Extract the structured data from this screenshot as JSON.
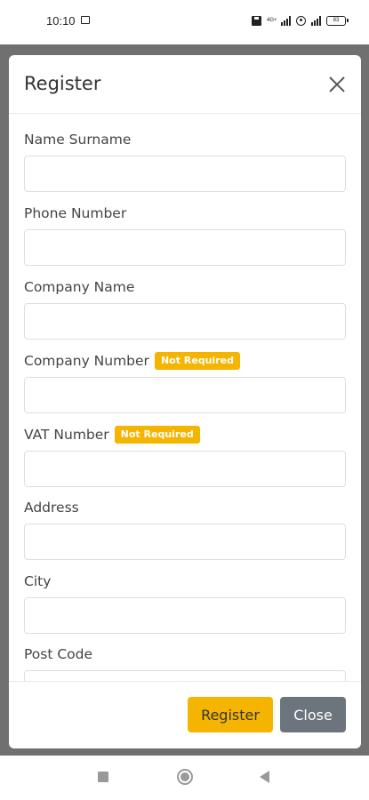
{
  "status_bar": {
    "time": "10:10",
    "network_label": "4G+",
    "battery": "83"
  },
  "modal": {
    "title": "Register",
    "fields": [
      {
        "label": "Name Surname",
        "value": "",
        "placeholder": ""
      },
      {
        "label": "Phone Number",
        "value": "",
        "placeholder": ""
      },
      {
        "label": "Company Name",
        "value": "",
        "placeholder": ""
      },
      {
        "label": "Company Number",
        "badge": "Not Required",
        "value": "",
        "placeholder": ""
      },
      {
        "label": "VAT Number",
        "badge": "Not Required",
        "value": "",
        "placeholder": ""
      },
      {
        "label": "Address",
        "value": "",
        "placeholder": ""
      },
      {
        "label": "City",
        "value": "",
        "placeholder": ""
      },
      {
        "label": "Post Code",
        "value": "",
        "placeholder": ""
      }
    ],
    "footer": {
      "register_label": "Register",
      "close_label": "Close"
    }
  },
  "colors": {
    "accent": "#f5b400",
    "close_button": "#6c757d",
    "backdrop": "#707070"
  },
  "icons": {
    "close": "close-icon",
    "nav_recents": "square-icon",
    "nav_home": "circle-icon",
    "nav_back": "triangle-back-icon"
  }
}
